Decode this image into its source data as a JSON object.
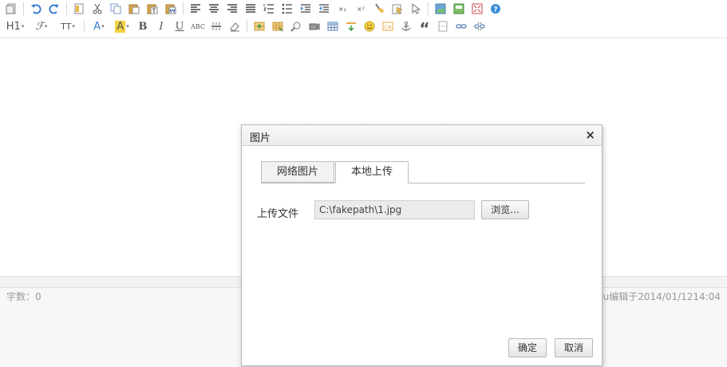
{
  "toolbar": {
    "heading_label": "H1",
    "font_family_glyph": "ℱ",
    "font_size_label": "TT",
    "font_color_label": "A",
    "bg_color_label": "A",
    "bold_label": "B",
    "italic_label": "I",
    "underline_label": "U",
    "strike_label": "ABC",
    "subscript_label": "×₂",
    "superscript_label": "×²",
    "quote_label": "“",
    "accent_color": "#3a8fd9"
  },
  "status": {
    "word_count": "字数：0",
    "edit_info": "uyu编辑于2014/01/1214:04"
  },
  "dialog": {
    "title": "图片",
    "close": "×",
    "tabs": [
      "网络图片",
      "本地上传"
    ],
    "upload_label": "上传文件",
    "file_path": "C:\\fakepath\\1.jpg",
    "browse": "浏览...",
    "ok": "确定",
    "cancel": "取消"
  }
}
